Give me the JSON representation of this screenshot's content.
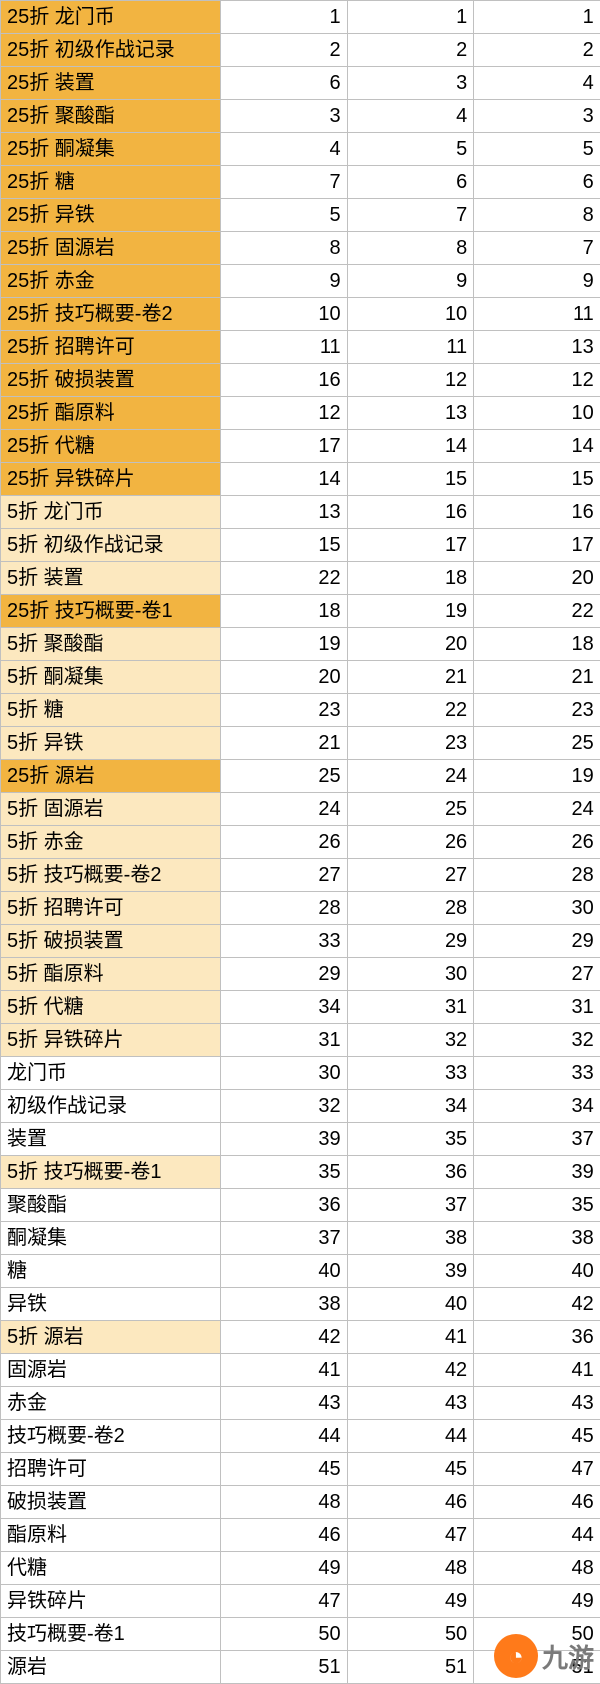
{
  "watermark": {
    "text": "九游"
  },
  "rows": [
    {
      "label": "25折 龙门币",
      "c1": 1,
      "c2": 1,
      "c3": 1,
      "tier": 0
    },
    {
      "label": "25折 初级作战记录",
      "c1": 2,
      "c2": 2,
      "c3": 2,
      "tier": 0
    },
    {
      "label": "25折 装置",
      "c1": 6,
      "c2": 3,
      "c3": 4,
      "tier": 0
    },
    {
      "label": "25折 聚酸酯",
      "c1": 3,
      "c2": 4,
      "c3": 3,
      "tier": 0
    },
    {
      "label": "25折 酮凝集",
      "c1": 4,
      "c2": 5,
      "c3": 5,
      "tier": 0
    },
    {
      "label": "25折 糖",
      "c1": 7,
      "c2": 6,
      "c3": 6,
      "tier": 0
    },
    {
      "label": "25折 异铁",
      "c1": 5,
      "c2": 7,
      "c3": 8,
      "tier": 0
    },
    {
      "label": "25折 固源岩",
      "c1": 8,
      "c2": 8,
      "c3": 7,
      "tier": 0
    },
    {
      "label": "25折 赤金",
      "c1": 9,
      "c2": 9,
      "c3": 9,
      "tier": 0
    },
    {
      "label": "25折 技巧概要-卷2",
      "c1": 10,
      "c2": 10,
      "c3": 11,
      "tier": 0
    },
    {
      "label": "25折 招聘许可",
      "c1": 11,
      "c2": 11,
      "c3": 13,
      "tier": 0
    },
    {
      "label": "25折 破损装置",
      "c1": 16,
      "c2": 12,
      "c3": 12,
      "tier": 0
    },
    {
      "label": "25折 酯原料",
      "c1": 12,
      "c2": 13,
      "c3": 10,
      "tier": 0
    },
    {
      "label": "25折 代糖",
      "c1": 17,
      "c2": 14,
      "c3": 14,
      "tier": 0
    },
    {
      "label": "25折 异铁碎片",
      "c1": 14,
      "c2": 15,
      "c3": 15,
      "tier": 0
    },
    {
      "label": "5折 龙门币",
      "c1": 13,
      "c2": 16,
      "c3": 16,
      "tier": 1
    },
    {
      "label": "5折 初级作战记录",
      "c1": 15,
      "c2": 17,
      "c3": 17,
      "tier": 1
    },
    {
      "label": "5折 装置",
      "c1": 22,
      "c2": 18,
      "c3": 20,
      "tier": 1
    },
    {
      "label": "25折 技巧概要-卷1",
      "c1": 18,
      "c2": 19,
      "c3": 22,
      "tier": 0
    },
    {
      "label": "5折 聚酸酯",
      "c1": 19,
      "c2": 20,
      "c3": 18,
      "tier": 1
    },
    {
      "label": "5折 酮凝集",
      "c1": 20,
      "c2": 21,
      "c3": 21,
      "tier": 1
    },
    {
      "label": "5折 糖",
      "c1": 23,
      "c2": 22,
      "c3": 23,
      "tier": 1
    },
    {
      "label": "5折 异铁",
      "c1": 21,
      "c2": 23,
      "c3": 25,
      "tier": 1
    },
    {
      "label": "25折 源岩",
      "c1": 25,
      "c2": 24,
      "c3": 19,
      "tier": 0
    },
    {
      "label": "5折 固源岩",
      "c1": 24,
      "c2": 25,
      "c3": 24,
      "tier": 1
    },
    {
      "label": "5折 赤金",
      "c1": 26,
      "c2": 26,
      "c3": 26,
      "tier": 1
    },
    {
      "label": "5折 技巧概要-卷2",
      "c1": 27,
      "c2": 27,
      "c3": 28,
      "tier": 1
    },
    {
      "label": "5折 招聘许可",
      "c1": 28,
      "c2": 28,
      "c3": 30,
      "tier": 1
    },
    {
      "label": "5折 破损装置",
      "c1": 33,
      "c2": 29,
      "c3": 29,
      "tier": 1
    },
    {
      "label": "5折 酯原料",
      "c1": 29,
      "c2": 30,
      "c3": 27,
      "tier": 1
    },
    {
      "label": "5折 代糖",
      "c1": 34,
      "c2": 31,
      "c3": 31,
      "tier": 1
    },
    {
      "label": "5折 异铁碎片",
      "c1": 31,
      "c2": 32,
      "c3": 32,
      "tier": 1
    },
    {
      "label": "龙门币",
      "c1": 30,
      "c2": 33,
      "c3": 33,
      "tier": 2
    },
    {
      "label": "初级作战记录",
      "c1": 32,
      "c2": 34,
      "c3": 34,
      "tier": 2
    },
    {
      "label": "装置",
      "c1": 39,
      "c2": 35,
      "c3": 37,
      "tier": 2
    },
    {
      "label": "5折 技巧概要-卷1",
      "c1": 35,
      "c2": 36,
      "c3": 39,
      "tier": 1
    },
    {
      "label": "聚酸酯",
      "c1": 36,
      "c2": 37,
      "c3": 35,
      "tier": 2
    },
    {
      "label": "酮凝集",
      "c1": 37,
      "c2": 38,
      "c3": 38,
      "tier": 2
    },
    {
      "label": "糖",
      "c1": 40,
      "c2": 39,
      "c3": 40,
      "tier": 2
    },
    {
      "label": "异铁",
      "c1": 38,
      "c2": 40,
      "c3": 42,
      "tier": 2
    },
    {
      "label": "5折 源岩",
      "c1": 42,
      "c2": 41,
      "c3": 36,
      "tier": 1
    },
    {
      "label": "固源岩",
      "c1": 41,
      "c2": 42,
      "c3": 41,
      "tier": 2
    },
    {
      "label": "赤金",
      "c1": 43,
      "c2": 43,
      "c3": 43,
      "tier": 2
    },
    {
      "label": "技巧概要-卷2",
      "c1": 44,
      "c2": 44,
      "c3": 45,
      "tier": 2
    },
    {
      "label": "招聘许可",
      "c1": 45,
      "c2": 45,
      "c3": 47,
      "tier": 2
    },
    {
      "label": "破损装置",
      "c1": 48,
      "c2": 46,
      "c3": 46,
      "tier": 2
    },
    {
      "label": "酯原料",
      "c1": 46,
      "c2": 47,
      "c3": 44,
      "tier": 2
    },
    {
      "label": "代糖",
      "c1": 49,
      "c2": 48,
      "c3": 48,
      "tier": 2
    },
    {
      "label": "异铁碎片",
      "c1": 47,
      "c2": 49,
      "c3": 49,
      "tier": 2
    },
    {
      "label": "技巧概要-卷1",
      "c1": 50,
      "c2": 50,
      "c3": 50,
      "tier": 2
    },
    {
      "label": "源岩",
      "c1": 51,
      "c2": 51,
      "c3": 51,
      "tier": 2
    }
  ]
}
